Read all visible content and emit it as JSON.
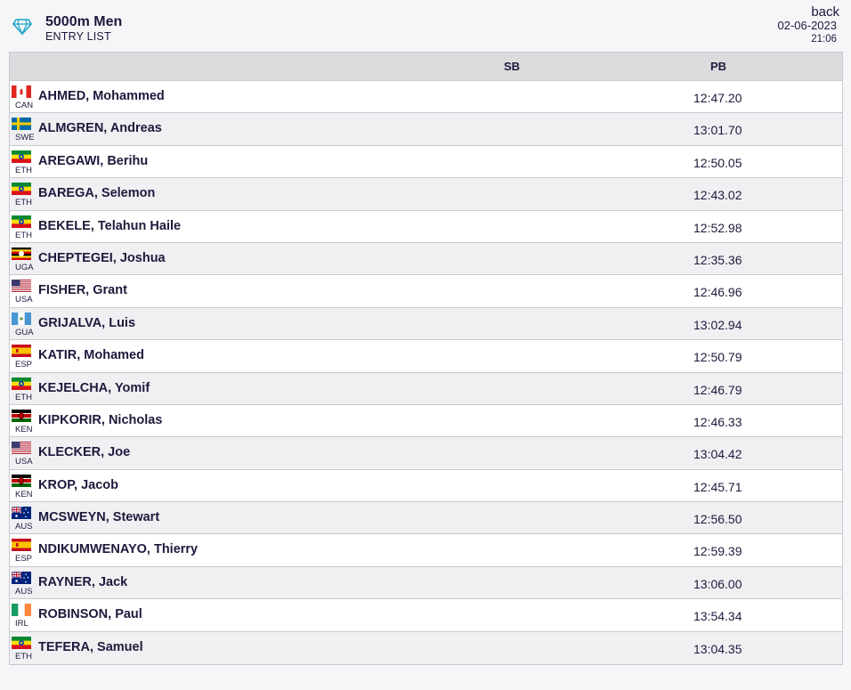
{
  "header": {
    "event_title": "5000m Men",
    "event_subtitle": "ENTRY LIST",
    "back_label": "back",
    "date": "02-06-2023",
    "time": "21:06"
  },
  "table": {
    "columns": {
      "sb": "SB",
      "pb": "PB"
    },
    "rows": [
      {
        "country": "CAN",
        "name": "AHMED, Mohammed",
        "sb": "",
        "pb": "12:47.20"
      },
      {
        "country": "SWE",
        "name": "ALMGREN, Andreas",
        "sb": "",
        "pb": "13:01.70"
      },
      {
        "country": "ETH",
        "name": "AREGAWI, Berihu",
        "sb": "",
        "pb": "12:50.05"
      },
      {
        "country": "ETH",
        "name": "BAREGA, Selemon",
        "sb": "",
        "pb": "12:43.02"
      },
      {
        "country": "ETH",
        "name": "BEKELE, Telahun Haile",
        "sb": "",
        "pb": "12:52.98"
      },
      {
        "country": "UGA",
        "name": "CHEPTEGEI, Joshua",
        "sb": "",
        "pb": "12:35.36"
      },
      {
        "country": "USA",
        "name": "FISHER, Grant",
        "sb": "",
        "pb": "12:46.96"
      },
      {
        "country": "GUA",
        "name": "GRIJALVA, Luis",
        "sb": "",
        "pb": "13:02.94"
      },
      {
        "country": "ESP",
        "name": "KATIR, Mohamed",
        "sb": "",
        "pb": "12:50.79"
      },
      {
        "country": "ETH",
        "name": "KEJELCHA, Yomif",
        "sb": "",
        "pb": "12:46.79"
      },
      {
        "country": "KEN",
        "name": "KIPKORIR, Nicholas",
        "sb": "",
        "pb": "12:46.33"
      },
      {
        "country": "USA",
        "name": "KLECKER, Joe",
        "sb": "",
        "pb": "13:04.42"
      },
      {
        "country": "KEN",
        "name": "KROP, Jacob",
        "sb": "",
        "pb": "12:45.71"
      },
      {
        "country": "AUS",
        "name": "MCSWEYN, Stewart",
        "sb": "",
        "pb": "12:56.50"
      },
      {
        "country": "ESP",
        "name": "NDIKUMWENAYO, Thierry",
        "sb": "",
        "pb": "12:59.39"
      },
      {
        "country": "AUS",
        "name": "RAYNER, Jack",
        "sb": "",
        "pb": "13:06.00"
      },
      {
        "country": "IRL",
        "name": "ROBINSON, Paul",
        "sb": "",
        "pb": "13:54.34"
      },
      {
        "country": "ETH",
        "name": "TEFERA, Samuel",
        "sb": "",
        "pb": "13:04.35"
      }
    ]
  }
}
